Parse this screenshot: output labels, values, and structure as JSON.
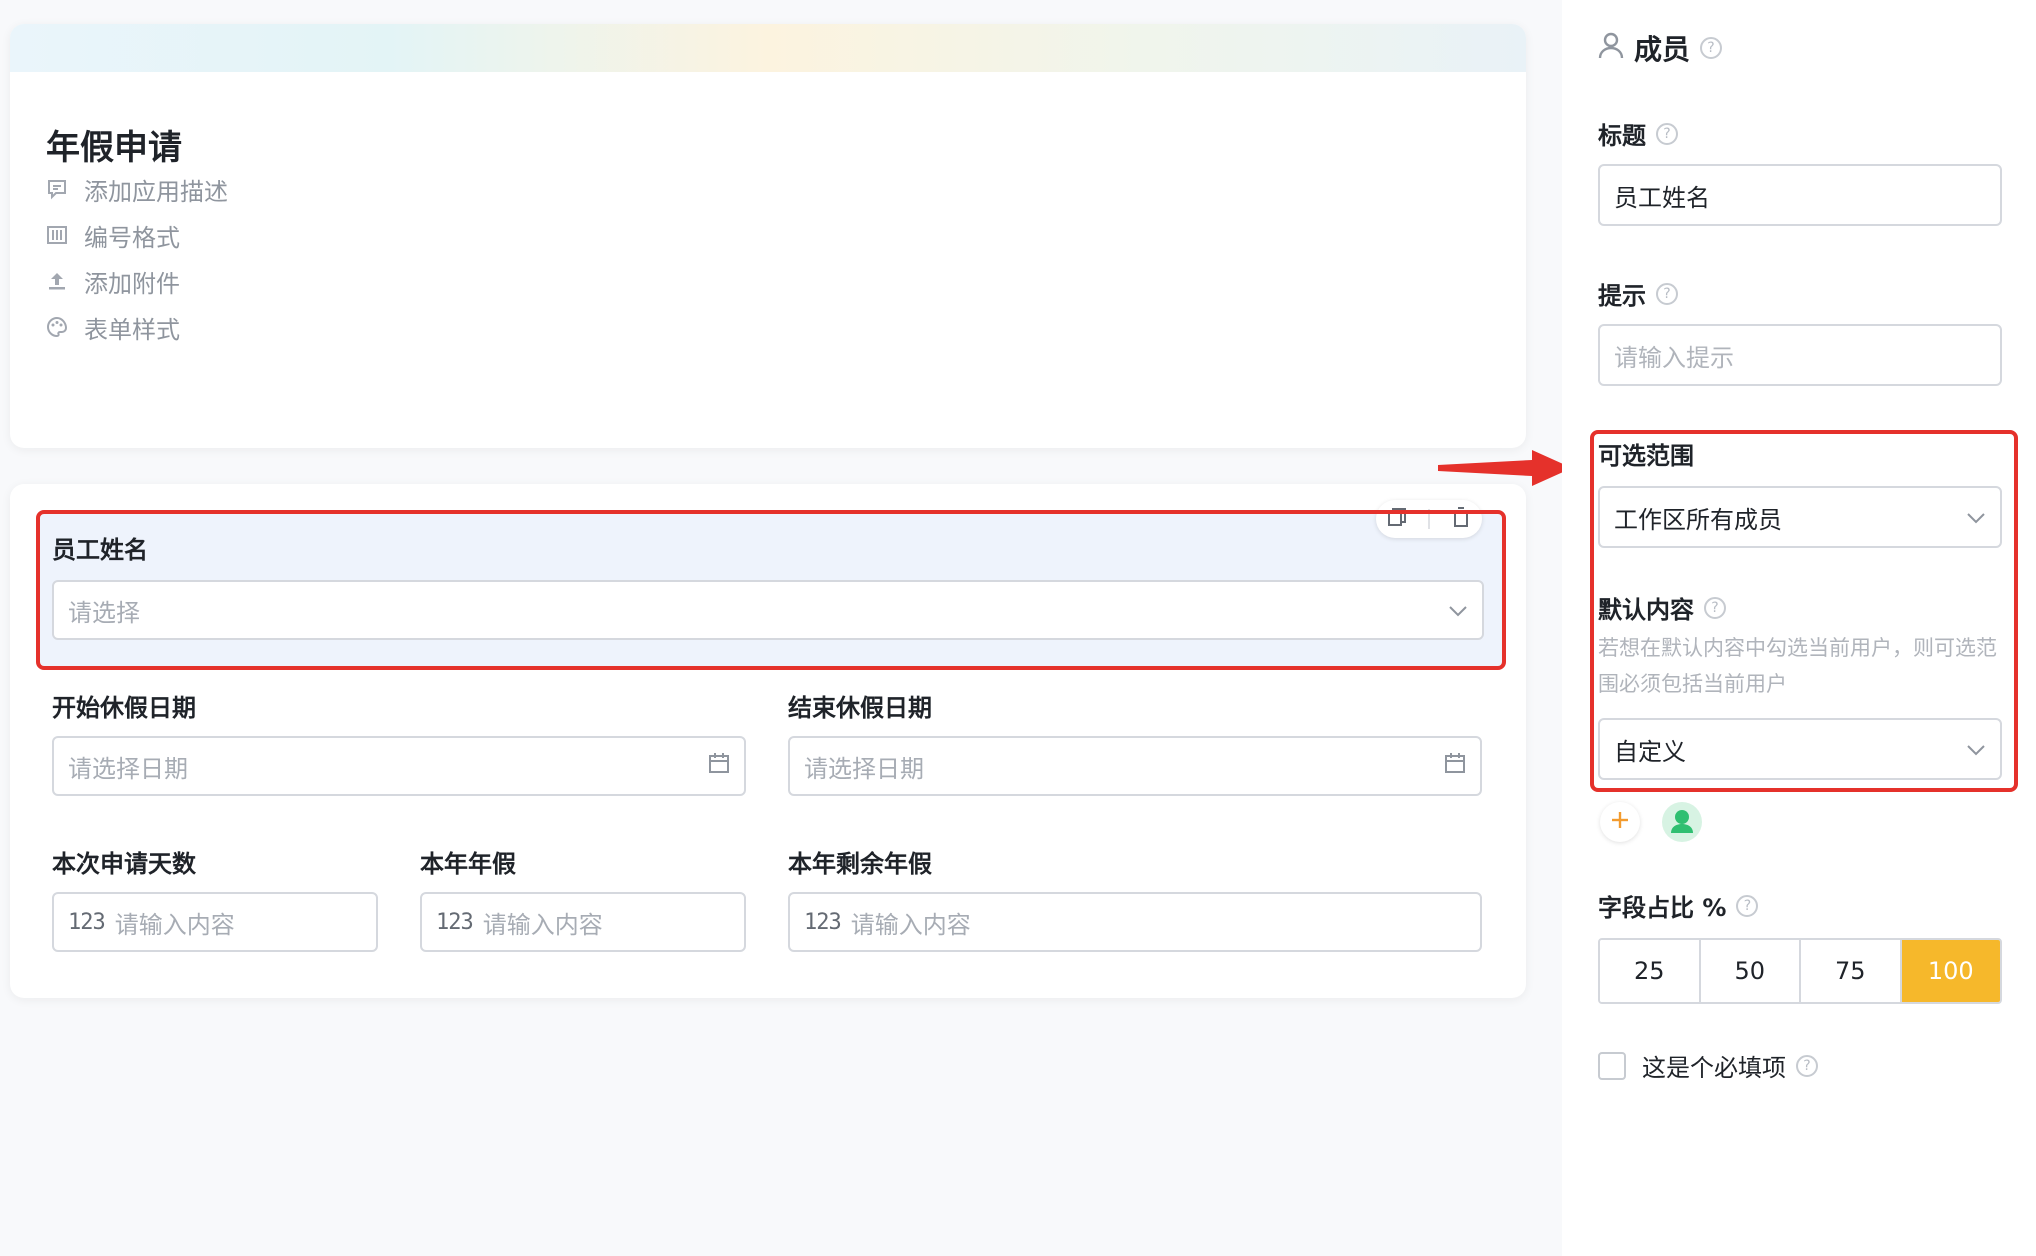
{
  "form": {
    "title": "年假申请",
    "head_items": [
      {
        "icon": "comment-icon",
        "label": "添加应用描述"
      },
      {
        "icon": "number-format-icon",
        "label": "编号格式"
      },
      {
        "icon": "upload-icon",
        "label": "添加附件"
      },
      {
        "icon": "palette-icon",
        "label": "表单样式"
      }
    ],
    "fields": {
      "employee_name": {
        "label": "员工姓名",
        "placeholder": "请选择"
      },
      "start_date": {
        "label": "开始休假日期",
        "placeholder": "请选择日期"
      },
      "end_date": {
        "label": "结束休假日期",
        "placeholder": "请选择日期"
      },
      "days": {
        "label": "本次申请天数",
        "placeholder": "请输入内容"
      },
      "annual": {
        "label": "本年年假",
        "placeholder": "请输入内容"
      },
      "remaining": {
        "label": "本年剩余年假",
        "placeholder": "请输入内容"
      }
    },
    "number_icon_text": "123"
  },
  "panel": {
    "type_label": "成员",
    "title_label": "标题",
    "title_value": "员工姓名",
    "hint_label": "提示",
    "hint_placeholder": "请输入提示",
    "range_label": "可选范围",
    "range_value": "工作区所有成员",
    "default_label": "默认内容",
    "default_hint": "若想在默认内容中勾选当前用户，则可选范围必须包括当前用户",
    "default_value": "自定义",
    "width_label": "字段占比 %",
    "width_options": [
      "25",
      "50",
      "75",
      "100"
    ],
    "width_selected": "100",
    "required_label": "这是个必填项"
  },
  "colors": {
    "accent": "#f6b82b",
    "highlight": "#e5312b",
    "selected_bg": "#eef3fc",
    "avatar_green": "#2fbf71"
  }
}
